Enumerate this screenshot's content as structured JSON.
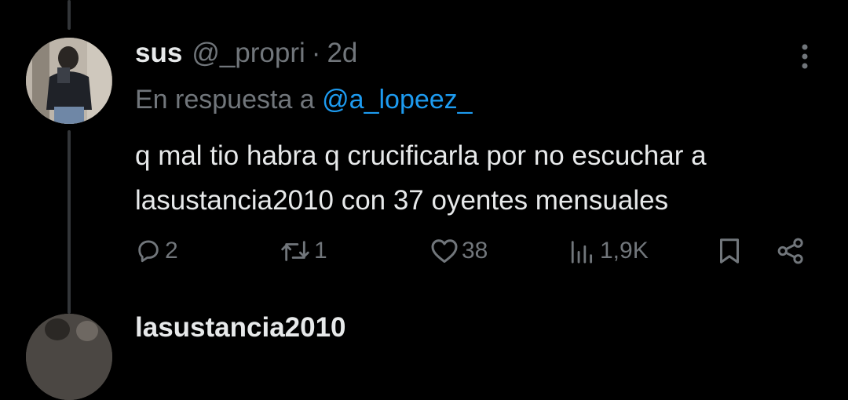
{
  "tweet": {
    "display_name": "sus",
    "handle": "@_propri",
    "separator": "·",
    "time": "2d",
    "reply_prefix": "En respuesta a",
    "reply_mention": "@a_lopeez_",
    "text": "q mal tio habra q crucificarla por no escuchar a lasustancia2010 con 37 oyentes mensuales",
    "actions": {
      "replies": "2",
      "retweets": "1",
      "likes": "38",
      "views": "1,9K"
    }
  },
  "next_reply": {
    "display_name": "lasustancia2010"
  },
  "icons": {
    "more": "more-vertical-icon",
    "reply": "reply-icon",
    "retweet": "retweet-icon",
    "like": "heart-icon",
    "views": "views-icon",
    "bookmark": "bookmark-icon",
    "share": "share-icon"
  },
  "colors": {
    "background": "#000000",
    "text": "#e7e9ea",
    "muted": "#71767b",
    "link": "#1d9bf0",
    "thread_line": "#333639"
  }
}
